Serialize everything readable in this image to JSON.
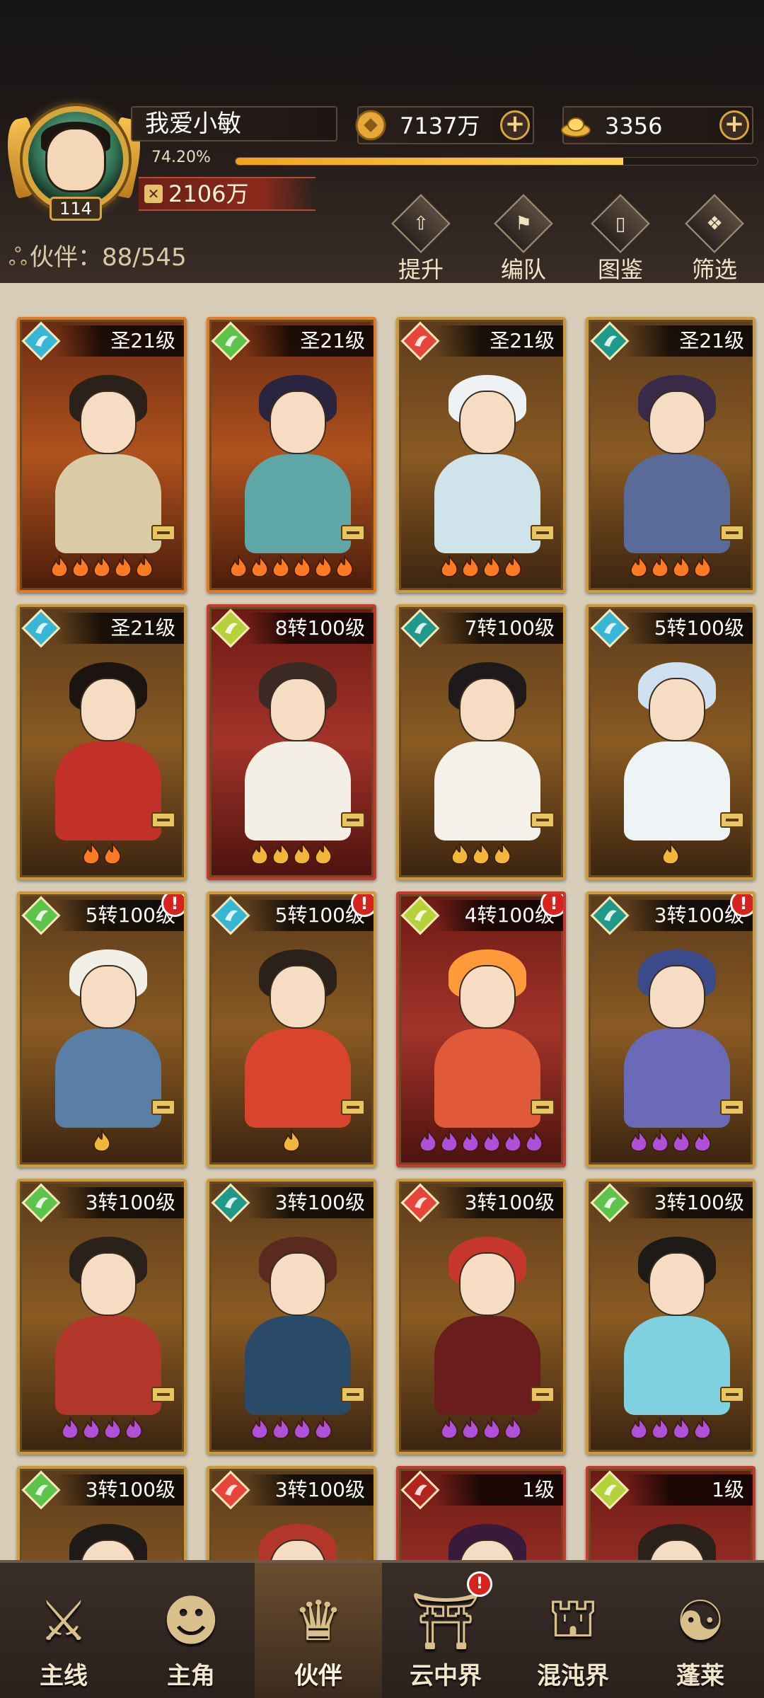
{
  "player": {
    "name": "我爱小敏",
    "level": "114",
    "exp_percent_text": "74.20%",
    "exp_fraction": 0.742,
    "power": "2106万"
  },
  "currencies": {
    "coin": {
      "value": "7137万",
      "icon": "coin-icon"
    },
    "gold": {
      "value": "3356",
      "icon": "gold-ingot-icon"
    }
  },
  "partners": {
    "label": "伙伴：88/545"
  },
  "tools": [
    {
      "label": "提升",
      "icon": "upgrade-icon"
    },
    {
      "label": "编队",
      "icon": "formation-flag-icon"
    },
    {
      "label": "图鉴",
      "icon": "scroll-icon"
    },
    {
      "label": "筛选",
      "icon": "filter-icon"
    }
  ],
  "cards": [
    {
      "level": "圣21级",
      "element": "water",
      "flames": 5,
      "flame_color": "#ff7a22",
      "frame": "orange",
      "hair": "#2a211b",
      "body": "#d8cba6",
      "notify": false
    },
    {
      "level": "圣21级",
      "element": "wood",
      "flames": 6,
      "flame_color": "#ff7a22",
      "frame": "orange",
      "hair": "#2a2440",
      "body": "#5fa6a6",
      "notify": false
    },
    {
      "level": "圣21级",
      "element": "fire",
      "flames": 4,
      "flame_color": "#ff7a22",
      "frame": "normal",
      "hair": "#eef2f4",
      "body": "#cfe3ea",
      "notify": false
    },
    {
      "level": "圣21级",
      "element": "dark",
      "flames": 4,
      "flame_color": "#ff7a22",
      "frame": "normal",
      "hair": "#3a2a4a",
      "body": "#5a6b9a",
      "notify": false
    },
    {
      "level": "圣21级",
      "element": "water",
      "flames": 2,
      "flame_color": "#ff7a22",
      "frame": "normal",
      "hair": "#1b1410",
      "body": "#c2302a",
      "notify": false
    },
    {
      "level": "8转100级",
      "element": "light",
      "flames": 4,
      "flame_color": "#f2b63a",
      "frame": "red",
      "hair": "#3b2a24",
      "body": "#f3efe6",
      "notify": false
    },
    {
      "level": "7转100级",
      "element": "dark",
      "flames": 3,
      "flame_color": "#f2b63a",
      "frame": "normal",
      "hair": "#1e1a1c",
      "body": "#f3f1ea",
      "notify": false
    },
    {
      "level": "5转100级",
      "element": "water",
      "flames": 1,
      "flame_color": "#f2b63a",
      "frame": "normal",
      "hair": "#cfe0f0",
      "body": "#eef3f6",
      "notify": false
    },
    {
      "level": "5转100级",
      "element": "wood",
      "flames": 1,
      "flame_color": "#f2b63a",
      "frame": "normal",
      "hair": "#f2efe8",
      "body": "#5a7fa6",
      "notify": true
    },
    {
      "level": "5转100级",
      "element": "water",
      "flames": 1,
      "flame_color": "#f2b63a",
      "frame": "normal",
      "hair": "#2a211b",
      "body": "#d9442e",
      "notify": true
    },
    {
      "level": "4转100级",
      "element": "light",
      "flames": 6,
      "flame_color": "#b04fd8",
      "frame": "red",
      "hair": "#ff9a3a",
      "body": "#e05a3a",
      "notify": true
    },
    {
      "level": "3转100级",
      "element": "dark",
      "flames": 4,
      "flame_color": "#b04fd8",
      "frame": "normal",
      "hair": "#3b4a8a",
      "body": "#6a6ab8",
      "notify": true
    },
    {
      "level": "3转100级",
      "element": "wood",
      "flames": 4,
      "flame_color": "#b04fd8",
      "frame": "normal",
      "hair": "#2a211b",
      "body": "#b3362a",
      "notify": false
    },
    {
      "level": "3转100级",
      "element": "dark",
      "flames": 4,
      "flame_color": "#b04fd8",
      "frame": "normal",
      "hair": "#5a2a1e",
      "body": "#2a4a6a",
      "notify": false
    },
    {
      "level": "3转100级",
      "element": "fire",
      "flames": 4,
      "flame_color": "#b04fd8",
      "frame": "normal",
      "hair": "#c5372c",
      "body": "#6b1c1c",
      "notify": false
    },
    {
      "level": "3转100级",
      "element": "wood",
      "flames": 4,
      "flame_color": "#b04fd8",
      "frame": "normal",
      "hair": "#1e1a18",
      "body": "#7fd0e0",
      "notify": false
    },
    {
      "level": "3转100级",
      "element": "wood",
      "flames": 0,
      "flame_color": "#b04fd8",
      "frame": "normal",
      "hair": "#1e1a18",
      "body": "#3a3a3a",
      "notify": false
    },
    {
      "level": "3转100级",
      "element": "fire",
      "flames": 0,
      "flame_color": "#b04fd8",
      "frame": "normal",
      "hair": "#b3362a",
      "body": "#c24a2a",
      "notify": false
    },
    {
      "level": "1级",
      "element": "fire-dark",
      "flames": 0,
      "flame_color": "#b04fd8",
      "frame": "red",
      "hair": "#3a1a3a",
      "body": "#5a3a5a",
      "notify": false
    },
    {
      "level": "1级",
      "element": "light",
      "flames": 0,
      "flame_color": "#b04fd8",
      "frame": "red",
      "hair": "#2a211b",
      "body": "#d8cba6",
      "notify": false
    }
  ],
  "element_colors": {
    "water": "#37b6d6",
    "wood": "#5cc44a",
    "fire": "#e8453a",
    "dark": "#1f9a8a",
    "light": "#b6d23a",
    "fire-dark": "#b3241e"
  },
  "bottom_nav": [
    {
      "label": "主线",
      "icon": "crossed-swords-icon",
      "active": false,
      "notify": false
    },
    {
      "label": "主角",
      "icon": "hero-portrait-icon",
      "active": false,
      "notify": false
    },
    {
      "label": "伙伴",
      "icon": "partner-crown-icon",
      "active": true,
      "notify": false
    },
    {
      "label": "云中界",
      "icon": "pagoda-icon",
      "active": false,
      "notify": true
    },
    {
      "label": "混沌界",
      "icon": "chaos-gate-icon",
      "active": false,
      "notify": false
    },
    {
      "label": "蓬莱",
      "icon": "sage-icon",
      "active": false,
      "notify": false
    }
  ]
}
